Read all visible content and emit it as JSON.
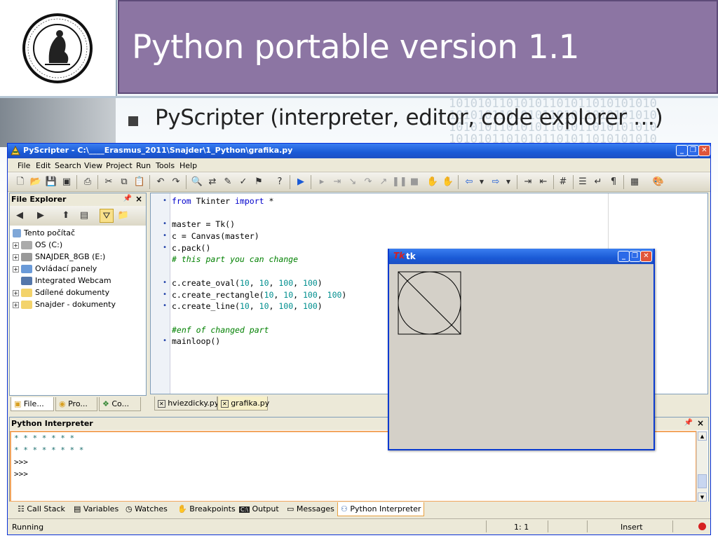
{
  "slide": {
    "title": "Python portable version 1.1",
    "bullet": "PyScripter (interpreter, editor, code explorer …)",
    "binary_pattern": "10101011010101101011010101010"
  },
  "ide": {
    "window_title": "PyScripter - C:\\____Erasmus_2011\\Snajder\\1_Python\\grafika.py",
    "menu": [
      "File",
      "Edit",
      "Search",
      "View",
      "Project",
      "Run",
      "Tools",
      "Help"
    ],
    "file_explorer": {
      "title": "File Explorer",
      "tree": [
        "Tento počítač",
        "OS (C:)",
        "SNAJDER_8GB (E:)",
        "Ovládací panely",
        "Integrated Webcam",
        "Sdílené dokumenty",
        "Snajder - dokumenty"
      ],
      "tabs": [
        "File...",
        "Pro...",
        "Co..."
      ]
    },
    "editor": {
      "lines": [
        {
          "t": "code",
          "parts": [
            [
              "kw",
              "from"
            ],
            [
              "",
              " Tkinter "
            ],
            [
              "kw",
              "import"
            ],
            [
              "",
              " *"
            ]
          ]
        },
        {
          "t": "blank"
        },
        {
          "t": "code",
          "parts": [
            [
              "",
              "master = Tk()"
            ]
          ]
        },
        {
          "t": "code",
          "parts": [
            [
              "",
              "c = Canvas(master)"
            ]
          ]
        },
        {
          "t": "code",
          "parts": [
            [
              "",
              "c.pack()"
            ]
          ]
        },
        {
          "t": "comment",
          "parts": [
            [
              "cm",
              "# this part you can change"
            ]
          ]
        },
        {
          "t": "blank"
        },
        {
          "t": "code",
          "parts": [
            [
              "",
              "c.create_oval("
            ],
            [
              "num",
              "10"
            ],
            [
              "",
              ", "
            ],
            [
              "num",
              "10"
            ],
            [
              "",
              ", "
            ],
            [
              "num",
              "100"
            ],
            [
              "",
              ", "
            ],
            [
              "num",
              "100"
            ],
            [
              "",
              ")"
            ]
          ]
        },
        {
          "t": "code",
          "parts": [
            [
              "",
              "c.create_rectangle("
            ],
            [
              "num",
              "10"
            ],
            [
              "",
              ", "
            ],
            [
              "num",
              "10"
            ],
            [
              "",
              ", "
            ],
            [
              "num",
              "100"
            ],
            [
              "",
              ", "
            ],
            [
              "num",
              "100"
            ],
            [
              "",
              ")"
            ]
          ]
        },
        {
          "t": "code",
          "parts": [
            [
              "",
              "c.create_line("
            ],
            [
              "num",
              "10"
            ],
            [
              "",
              ", "
            ],
            [
              "num",
              "10"
            ],
            [
              "",
              ", "
            ],
            [
              "num",
              "100"
            ],
            [
              "",
              ", "
            ],
            [
              "num",
              "100"
            ],
            [
              "",
              ")"
            ]
          ]
        },
        {
          "t": "blank"
        },
        {
          "t": "comment",
          "parts": [
            [
              "cm",
              "#enf of changed part"
            ]
          ]
        },
        {
          "t": "code",
          "parts": [
            [
              "",
              "mainloop()"
            ]
          ]
        }
      ],
      "tabs": [
        "hviezdicky.py",
        "grafika.py"
      ]
    },
    "tk_window": {
      "logo": "Tk",
      "title": "tk"
    },
    "interpreter": {
      "title": "Python Interpreter",
      "lines": [
        "* * * * * * *",
        "* * * * * * * *",
        ">>>",
        ">>>"
      ]
    },
    "bottom_tabs": [
      "Call Stack",
      "Variables",
      "Watches",
      "Breakpoints",
      "Output",
      "Messages",
      "Python Interpreter"
    ],
    "status": {
      "left": "Running",
      "position": "1:  1",
      "mode": "Insert"
    }
  },
  "colors": {
    "title_bg": "#8c75a3",
    "xp_blue": "#1a5ad6",
    "comment": "#008000",
    "number": "#008f8f",
    "keyword": "#0000cc"
  }
}
